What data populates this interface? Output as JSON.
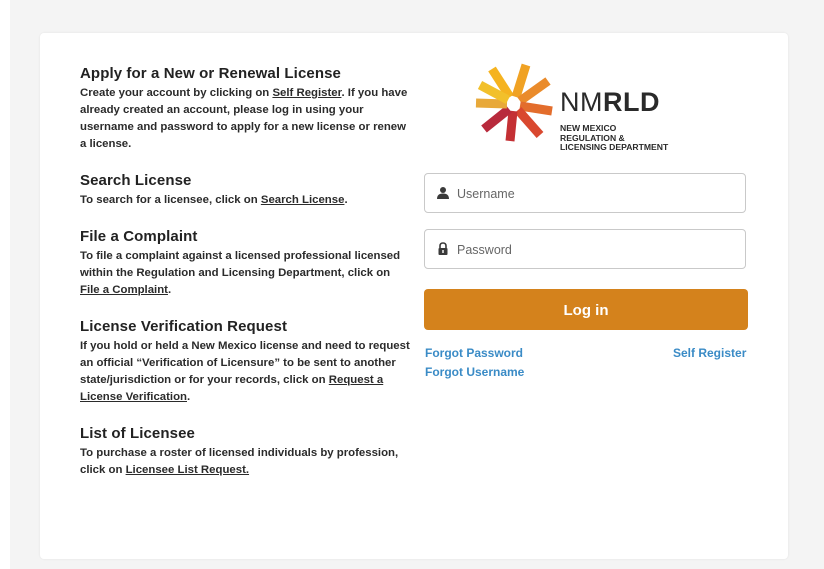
{
  "sections": [
    {
      "title": "Apply for a New or Renewal License",
      "text_before": "Create your account by clicking on ",
      "link": "Self Register",
      "text_after": ". If you have already created an account, please log in using your username and password to apply for a new license or renew a license."
    },
    {
      "title": "Search License",
      "text_before": "To search for a licensee, click on ",
      "link": "Search License",
      "text_after": "."
    },
    {
      "title": "File a Complaint",
      "text_before": "To file a complaint against a licensed professional licensed within the Regulation and Licensing Department, click on ",
      "link": "File a Complaint",
      "text_after": "."
    },
    {
      "title": "License Verification Request",
      "text_before": "If you hold or held a New Mexico license and need to request an official “Verification of Licensure” to be sent to another state/jurisdiction or for your records, click on ",
      "link": "Request a License Verification",
      "text_after": "."
    },
    {
      "title": "List of Licensee",
      "text_before": "To purchase a roster of licensed individuals by profession, click on ",
      "link": "Licensee List Request.",
      "text_after": ""
    }
  ],
  "logo": {
    "wordmark_thin": "NM",
    "wordmark_bold": "RLD",
    "dept_line1": "NEW MEXICO",
    "dept_line2": "REGULATION &",
    "dept_line3": "LICENSING DEPARTMENT"
  },
  "login": {
    "username_placeholder": "Username",
    "password_placeholder": "Password",
    "button_label": "Log in",
    "forgot_password": "Forgot Password",
    "forgot_username": "Forgot Username",
    "self_register": "Self Register",
    "username_icon": "user-icon",
    "password_icon": "lock-icon"
  },
  "colors": {
    "accent": "#d4821c",
    "link": "#3a8bc6"
  }
}
